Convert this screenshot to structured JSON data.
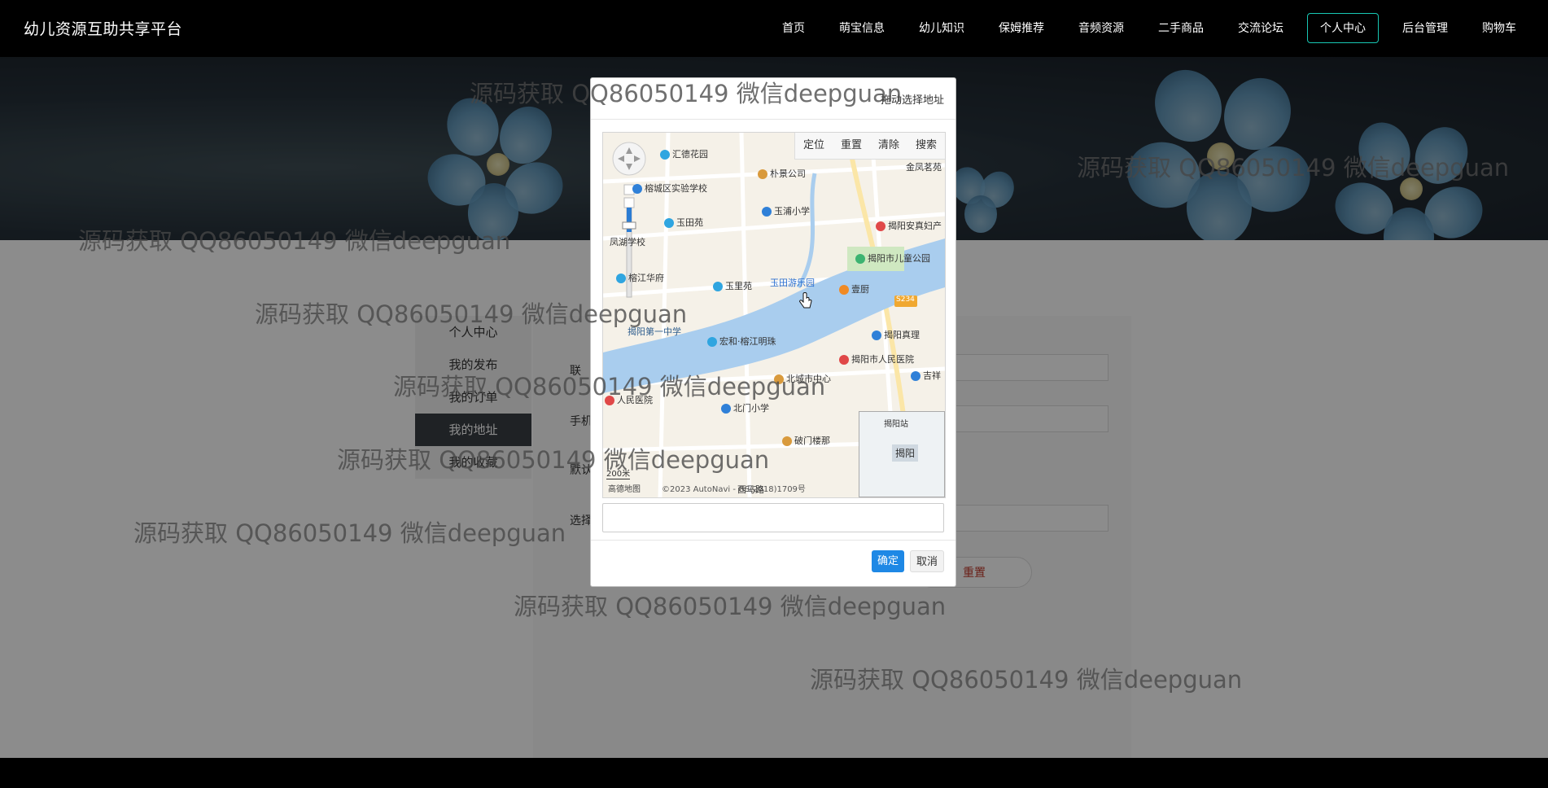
{
  "brand": "幼儿资源互助共享平台",
  "nav": {
    "items": [
      {
        "label": "首页"
      },
      {
        "label": "萌宝信息"
      },
      {
        "label": "幼儿知识"
      },
      {
        "label": "保姆推荐"
      },
      {
        "label": "音频资源"
      },
      {
        "label": "二手商品"
      },
      {
        "label": "交流论坛"
      },
      {
        "label": "个人中心",
        "active": true
      },
      {
        "label": "后台管理"
      },
      {
        "label": "购物车"
      }
    ]
  },
  "sidebar": {
    "items": [
      {
        "label": "个人中心"
      },
      {
        "label": "我的发布"
      },
      {
        "label": "我的订单"
      },
      {
        "label": "我的地址",
        "active": true
      },
      {
        "label": "我的收藏"
      }
    ]
  },
  "form": {
    "label_contact": "联",
    "label_phone": "手机",
    "label_default": "默认",
    "label_select": "选择",
    "reset_label": "重置"
  },
  "modal": {
    "title": "拖动选择地址",
    "tools": [
      "定位",
      "重置",
      "清除",
      "搜索"
    ],
    "ok_label": "确定",
    "cancel_label": "取消",
    "map": {
      "pois": [
        "汇德花园",
        "榕城区实验学校",
        "朴景公司",
        "玉田苑",
        "玉浦小学",
        "凤湖学校",
        "揭阳市儿童公园",
        "揭阳安真妇产",
        "榕江华府",
        "玉里苑",
        "玉田游乐园",
        "壹厨",
        "揭阳第一中学",
        "宏和·榕江明珠",
        "揭阳真理",
        "北城市中心",
        "揭阳市人民医院",
        "人民医院",
        "北门小学",
        "破门楼那",
        "揭阳站",
        "揭阳",
        "S234",
        "吉祥",
        "金凤茗苑",
        "西马路"
      ],
      "scale_label": "200米",
      "logo_label": "高德地图",
      "copyright": "©2023 AutoNavi - GS(2018)1709号"
    }
  },
  "watermark": "源码获取 QQ86050149 微信deepguan",
  "colors": {
    "nav_bg": "#000000",
    "active_border": "#18c7b4",
    "ok_button": "#1e88e5",
    "river": "#a9cdee"
  }
}
